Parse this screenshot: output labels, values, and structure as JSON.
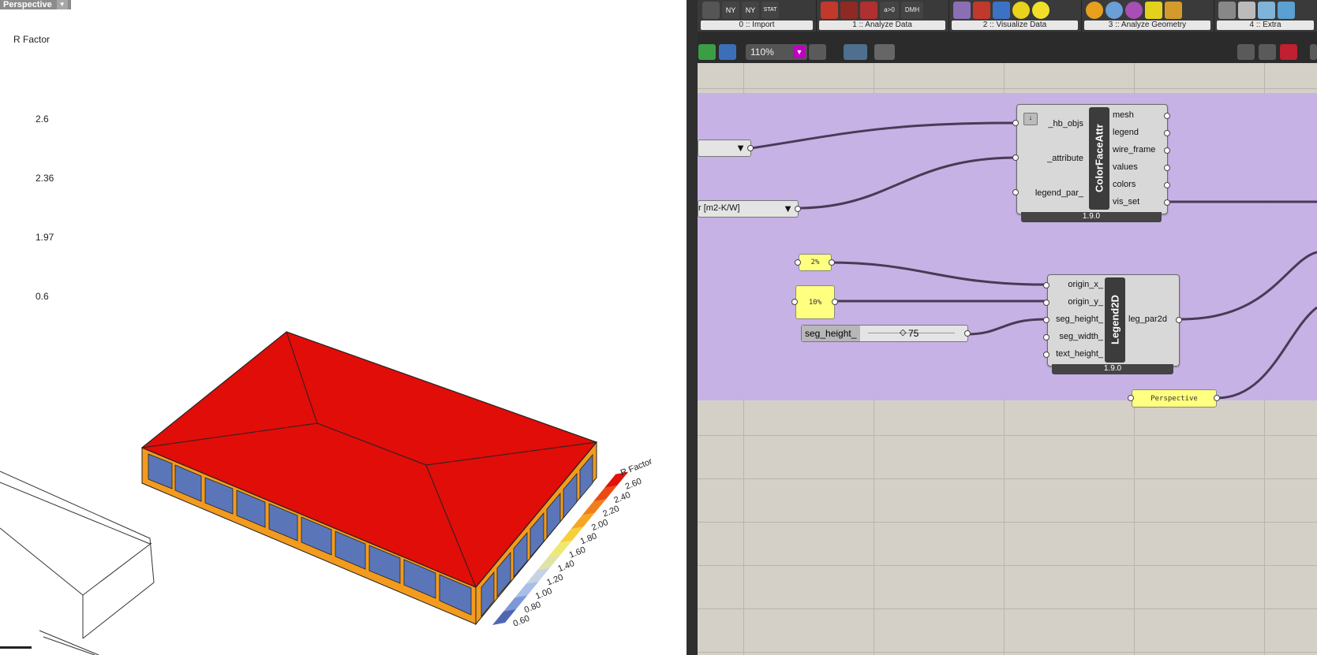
{
  "viewport": {
    "tab_label": "Perspective",
    "legend_title": "R Factor",
    "side_values": [
      "2.6",
      "2.36",
      "1.97",
      "0.6"
    ],
    "legend": {
      "title": "R Factor",
      "labels": [
        "2.60",
        "2.40",
        "2.20",
        "2.00",
        "1.80",
        "1.60",
        "1.40",
        "1.20",
        "1.00",
        "0.80",
        "0.60"
      ],
      "colors": [
        "#e0120b",
        "#ec4a15",
        "#f17e1c",
        "#f5a623",
        "#f6cf3d",
        "#efe871",
        "#dfe3a8",
        "#c6d3e2",
        "#a8bde8",
        "#7e97d6",
        "#4f67b3"
      ]
    }
  },
  "grasshopper": {
    "ribbon_groups": [
      {
        "label": "0 :: Import"
      },
      {
        "label": "1 :: Analyze Data"
      },
      {
        "label": "2 :: Visualize Data"
      },
      {
        "label": "3 :: Analyze Geometry"
      },
      {
        "label": "4 :: Extra"
      }
    ],
    "ribbon_icon_text": [
      "NY",
      "NY",
      "STAT",
      "a>0",
      "DMH"
    ],
    "zoom": "110%",
    "color_face_attr": {
      "title": "ColorFaceAttr",
      "inputs": [
        "_hb_objs",
        "_attribute",
        "legend_par_"
      ],
      "outputs": [
        "mesh",
        "legend",
        "wire_frame",
        "values",
        "colors",
        "vis_set"
      ],
      "version": "1.9.0"
    },
    "legend2d": {
      "title": "Legend2D",
      "inputs": [
        "origin_x_",
        "origin_y_",
        "seg_height_",
        "seg_width_",
        "text_height_"
      ],
      "outputs": [
        "leg_par2d"
      ],
      "version": "1.9.0"
    },
    "attribute_dropdown": "r [m2-K/W]",
    "panel_x": "2%",
    "panel_y": "10%",
    "slider": {
      "label": "seg_height_",
      "value": "75"
    },
    "perspective_panel": "Perspective"
  }
}
